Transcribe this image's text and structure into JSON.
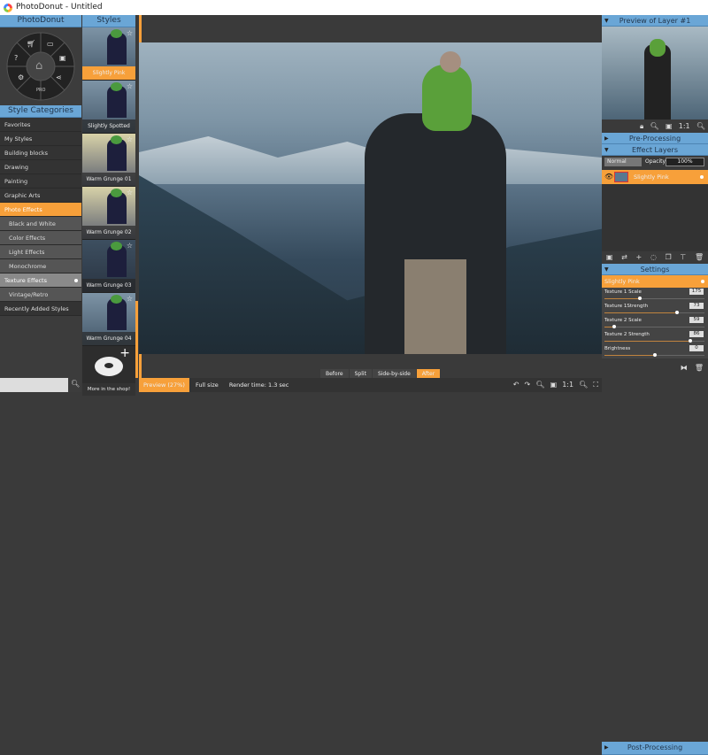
{
  "window": {
    "title": "PhotoDonut - Untitled"
  },
  "left": {
    "header": "PhotoDonut",
    "donut_center": "PRO",
    "categories_header": "Style Categories",
    "categories": [
      {
        "label": "Favorites",
        "type": "top"
      },
      {
        "label": "My Styles",
        "type": "top"
      },
      {
        "label": "Building blocks",
        "type": "top"
      },
      {
        "label": "Drawing",
        "type": "top"
      },
      {
        "label": "Painting",
        "type": "top"
      },
      {
        "label": "Graphic Arts",
        "type": "top"
      },
      {
        "label": "Photo Effects",
        "type": "active"
      },
      {
        "label": "Black and White",
        "type": "sub"
      },
      {
        "label": "Color Effects",
        "type": "sub"
      },
      {
        "label": "Light Effects",
        "type": "sub"
      },
      {
        "label": "Monochrome",
        "type": "sub"
      },
      {
        "label": "Texture Effects",
        "type": "sel"
      },
      {
        "label": "Vintage/Retro",
        "type": "sub"
      },
      {
        "label": "Recently Added Styles",
        "type": "top"
      }
    ],
    "search_placeholder": ""
  },
  "styles": {
    "header": "Styles",
    "items": [
      {
        "label": "Slightly Pink",
        "selected": true
      },
      {
        "label": "Slightly Spotted"
      },
      {
        "label": "Warm Grunge 01"
      },
      {
        "label": "Warm Grunge 02"
      },
      {
        "label": "Warm Grunge 03"
      },
      {
        "label": "Warm Grunge 04"
      }
    ],
    "shop": "More in the shop!"
  },
  "view": {
    "modes": [
      "Before",
      "Split",
      "Side-by-side",
      "After"
    ],
    "active": "After"
  },
  "bottom": {
    "preview": "Preview (27%)",
    "full_size": "Full size",
    "render_time": "Render time: 1.3 sec",
    "zoom_1to1": "1:1"
  },
  "right": {
    "preview_header": "Preview of Layer #1",
    "zoom_1to1": "1:1",
    "pre_processing": "Pre-Processing",
    "effect_layers": "Effect Layers",
    "blend_mode": "Normal",
    "opacity_label": "Opacity",
    "opacity_value": "100%",
    "layer_name": "Slightly Pink",
    "settings": "Settings",
    "settings_layer": "Slightly Pink",
    "sliders": [
      {
        "label": "Texture 1 Scale",
        "value": "175",
        "fraction": 0.35
      },
      {
        "label": "Texture 1Strength",
        "value": "73",
        "fraction": 0.73
      },
      {
        "label": "Texture 2 Scale",
        "value": "59",
        "fraction": 0.1
      },
      {
        "label": "Texture 2 Strength",
        "value": "86",
        "fraction": 0.86
      },
      {
        "label": "Brightness",
        "value": "0",
        "fraction": 0.5
      }
    ],
    "post_processing": "Post-Processing"
  },
  "colors": {
    "accent": "#f7a03a",
    "header": "#6aa6d6"
  }
}
